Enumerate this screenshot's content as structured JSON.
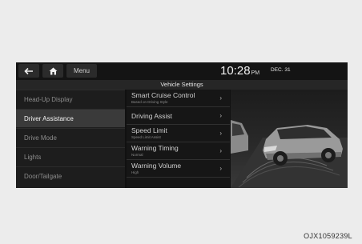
{
  "topbar": {
    "menu_label": "Menu",
    "time": "10:28",
    "ampm": "PM",
    "date": "DEC. 31"
  },
  "header": {
    "title": "Vehicle Settings"
  },
  "left_menu": [
    {
      "label": "Head-Up Display",
      "active": false
    },
    {
      "label": "Driver Assistance",
      "active": true
    },
    {
      "label": "Drive Mode",
      "active": false
    },
    {
      "label": "Lights",
      "active": false
    },
    {
      "label": "Door/Tailgate",
      "active": false
    }
  ],
  "sub_menu": [
    {
      "label": "Smart Cruise Control",
      "sub": "Based on Driving Style"
    },
    {
      "label": "Driving Assist",
      "sub": ""
    },
    {
      "label": "Speed Limit",
      "sub": "Speed Limit Assist"
    },
    {
      "label": "Warning Timing",
      "sub": "Normal"
    },
    {
      "label": "Warning Volume",
      "sub": "High"
    }
  ],
  "caption": "OJX1059239L",
  "icons": {
    "back": "back-arrow-icon",
    "home": "home-icon",
    "arrow": "chevron-right-icon"
  }
}
